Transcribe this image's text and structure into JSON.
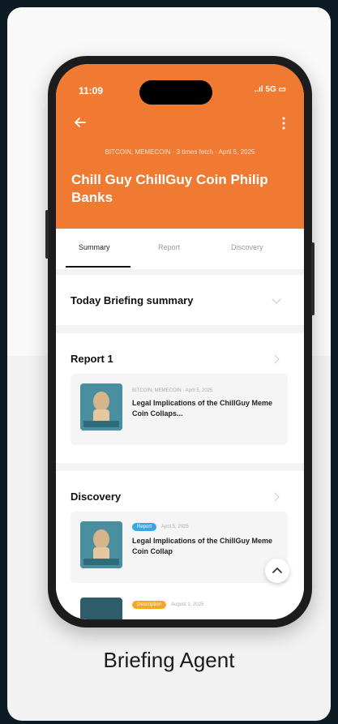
{
  "status_bar": {
    "time": "11:09",
    "icons": "..ıl 5G ▭"
  },
  "header": {
    "meta": "BITCOIN, MEMECOIN · 3 times fetch · April 5, 2025",
    "title": "Chill Guy ChillGuy Coin Philip Banks"
  },
  "tabs": [
    {
      "label": "Summary",
      "active": true
    },
    {
      "label": "Report",
      "active": false
    },
    {
      "label": "Discovery",
      "active": false
    }
  ],
  "briefing": {
    "title": "Today Briefing summary"
  },
  "report": {
    "title": "Report 1",
    "item": {
      "meta": "BITCOIN, MEMECOIN · April 5, 2025",
      "title": "Legal Implications of the ChillGuy Meme Coin Collaps..."
    }
  },
  "discovery": {
    "title": "Discovery",
    "items": [
      {
        "badge": "Report",
        "badge_color": "#3aa6e8",
        "date": "April 5, 2025",
        "title": "Legal Implications of the ChillGuy Meme Coin Collap"
      },
      {
        "badge": "Description",
        "badge_color": "#f5a623",
        "date": "August 1, 2025",
        "title": ""
      }
    ]
  },
  "caption": "Briefing Agent",
  "colors": {
    "accent": "#f07a32",
    "background": "#0d1b24"
  }
}
